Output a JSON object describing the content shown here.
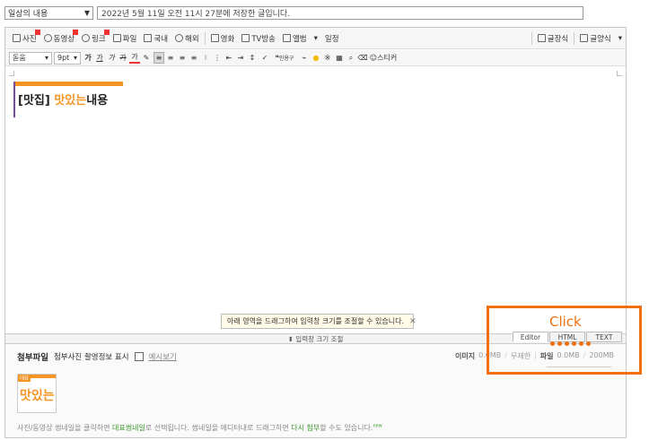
{
  "header": {
    "category": "일상의 내용",
    "title_value": "2022년 5월 11일 오전 11시 27분에 저장한 글입니다."
  },
  "toolbar1": {
    "items": [
      {
        "label": "사진",
        "icon": "photo-icon"
      },
      {
        "label": "동영상",
        "icon": "video-icon"
      },
      {
        "label": "링크",
        "icon": "link-icon"
      },
      {
        "label": "파일",
        "icon": "file-icon"
      },
      {
        "label": "국내",
        "icon": "domestic-map-icon"
      },
      {
        "label": "해외",
        "icon": "globe-icon"
      },
      {
        "label": "영화",
        "icon": "movie-icon"
      },
      {
        "label": "TV방송",
        "icon": "tv-icon"
      },
      {
        "label": "앨범",
        "icon": "album-icon"
      },
      {
        "label": "일정",
        "icon": "calendar-icon"
      }
    ],
    "right": [
      {
        "label": "글장식",
        "icon": "decorate-icon"
      },
      {
        "label": "글양식",
        "icon": "template-icon"
      }
    ]
  },
  "toolbar2": {
    "font": "돋움",
    "size": "9pt",
    "format_buttons": [
      "가",
      "가",
      "가",
      "가",
      "가"
    ],
    "quote_label": "인용구",
    "sticker_label": "스티커"
  },
  "canvas": {
    "heading_bracket": "[맛집]",
    "heading_orange": "맛있는",
    "heading_rest": "내용",
    "resize_tip": "아래 영역을 드래그하여 입력창 크기를 조절할 수 있습니다.",
    "resize_bar": "⬍ 입력창 크기 조절"
  },
  "mode_tabs": [
    "Editor",
    "HTML",
    "TEXT"
  ],
  "attach": {
    "title": "첨부파일",
    "exif_label": "첨부사진 촬영정보 표시",
    "preview": "예시보기",
    "image_label": "이미지",
    "image_value": "0.0MB",
    "image_limit": "무제한",
    "file_label": "파일",
    "file_value": "0.0MB",
    "file_limit": "200MB",
    "thumb_badge": "대표",
    "thumb_text": "맛있는",
    "note_a": "사진/동영상 썸네일을 클릭하면 ",
    "note_b": "대표썸네일",
    "note_c": "로 선택됩니다. 썸네일을 에디터내로 드래그하면 ",
    "note_d": "다시 첨부",
    "note_e": "할 수도 있습니다.",
    "note_new": "new"
  },
  "annotation": {
    "label": "Click",
    "color": "#f07010"
  },
  "colors": {
    "accent_orange": "#f59423",
    "heading_line": "#7a4b9a"
  }
}
